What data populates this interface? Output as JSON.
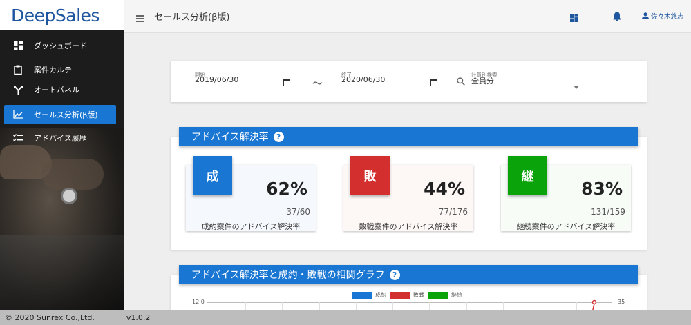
{
  "app": {
    "logo_text": "DeepSales",
    "page_title": "セールス分析(β版)",
    "user_name": "佐々木悠志"
  },
  "sidebar": {
    "items": [
      {
        "label": "ダッシュボード",
        "icon": "dashboard-icon",
        "active": false
      },
      {
        "label": "案件カルテ",
        "icon": "clipboard-icon",
        "active": false
      },
      {
        "label": "オートパネル",
        "icon": "branch-icon",
        "active": false
      },
      {
        "label": "セールス分析(β版)",
        "icon": "chart-line-icon",
        "active": true
      },
      {
        "label": "アドバイス履歴",
        "icon": "checklist-icon",
        "active": false
      }
    ]
  },
  "filter": {
    "start_label": "開始",
    "start_value": "2019/06/30",
    "separator": "〜",
    "end_label": "終了",
    "end_value": "2020/06/30",
    "employee_label": "社員別検索",
    "employee_value": "全員分"
  },
  "advice_section": {
    "title": "アドバイス解決率",
    "help": "?",
    "cards": [
      {
        "badge": "成",
        "percent": "62%",
        "fraction": "37/60",
        "caption": "成約案件のアドバイス解決率",
        "color": "#1976d2",
        "bg": "#f5f9fe"
      },
      {
        "badge": "敗",
        "percent": "44%",
        "fraction": "77/176",
        "caption": "敗戦案件のアドバイス解決率",
        "color": "#d32f2f",
        "bg": "#fdf8f6"
      },
      {
        "badge": "継",
        "percent": "83%",
        "fraction": "131/159",
        "caption": "継続案件のアドバイス解決率",
        "color": "#0aa30a",
        "bg": "#f7fcf7"
      }
    ]
  },
  "correlation_section": {
    "title": "アドバイス解決率と成約・敗戦の相関グラフ",
    "help": "?"
  },
  "chart_data": {
    "type": "line",
    "title": "",
    "series": [
      {
        "name": "成約",
        "color": "#1976d2"
      },
      {
        "name": "敗戦",
        "color": "#d32f2f"
      },
      {
        "name": "継続",
        "color": "#0aa30a"
      }
    ],
    "y_left_top_tick": "12.0",
    "y_right_top_tick": "35"
  },
  "footer": {
    "copyright": "© 2020 Sunrex Co.,Ltd.",
    "version": "v1.0.2"
  }
}
